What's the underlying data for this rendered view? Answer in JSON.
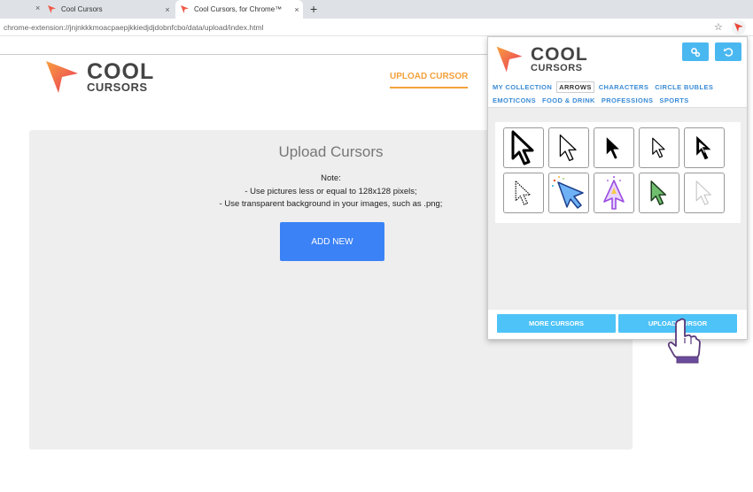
{
  "browser": {
    "tabs": [
      {
        "title": "Cool Cursors",
        "active": false
      },
      {
        "title": "Cool Cursors, for Chrome™",
        "active": true
      }
    ],
    "new_tab_symbol": "+",
    "close_symbol": "×",
    "url": "chrome-extension://jnjnkkkmoacpaepjkkiedjdjdobnfcbo/data/upload/index.html",
    "star_symbol": "☆"
  },
  "page": {
    "logo": {
      "line1": "COOL",
      "line2": "CURSORS"
    },
    "nav": {
      "upload_label": "UPLOAD CURSOR"
    },
    "upload": {
      "title": "Upload Cursors",
      "note_title": "Note:",
      "note_line1": "- Use pictures less or equal to 128x128 pixels;",
      "note_line2": "- Use transparent background in your images, such as .png;",
      "add_new_label": "ADD NEW"
    }
  },
  "popup": {
    "logo": {
      "line1": "COOL",
      "line2": "CURSORS"
    },
    "categories_row1": [
      "MY COLLECTION",
      "ARROWS",
      "CHARACTERS",
      "CIRCLE BUBLES"
    ],
    "categories_row2": [
      "EMOTICONS",
      "FOOD & DRINK",
      "PROFESSIONS",
      "SPORTS"
    ],
    "active_category": "ARROWS",
    "cursors": [
      "black-outline-arrow-cursor",
      "white-slim-arrow-cursor",
      "black-arrow-cursor",
      "small-white-arrow-cursor",
      "black-hollow-arrow-cursor",
      "dotted-arrow-cursor",
      "blue-sparkle-arrow-cursor",
      "purple-magic-arrow-cursor",
      "green-arrow-cursor",
      "light-grey-arrow-cursor"
    ],
    "more_label": "MORE CURSORS",
    "upload_label": "UPLOAD CURSOR"
  },
  "colors": {
    "accent_orange": "#f4a13b",
    "primary_blue": "#3b82f6",
    "popup_blue": "#4ec3f7",
    "link_blue": "#3a8bd6"
  }
}
